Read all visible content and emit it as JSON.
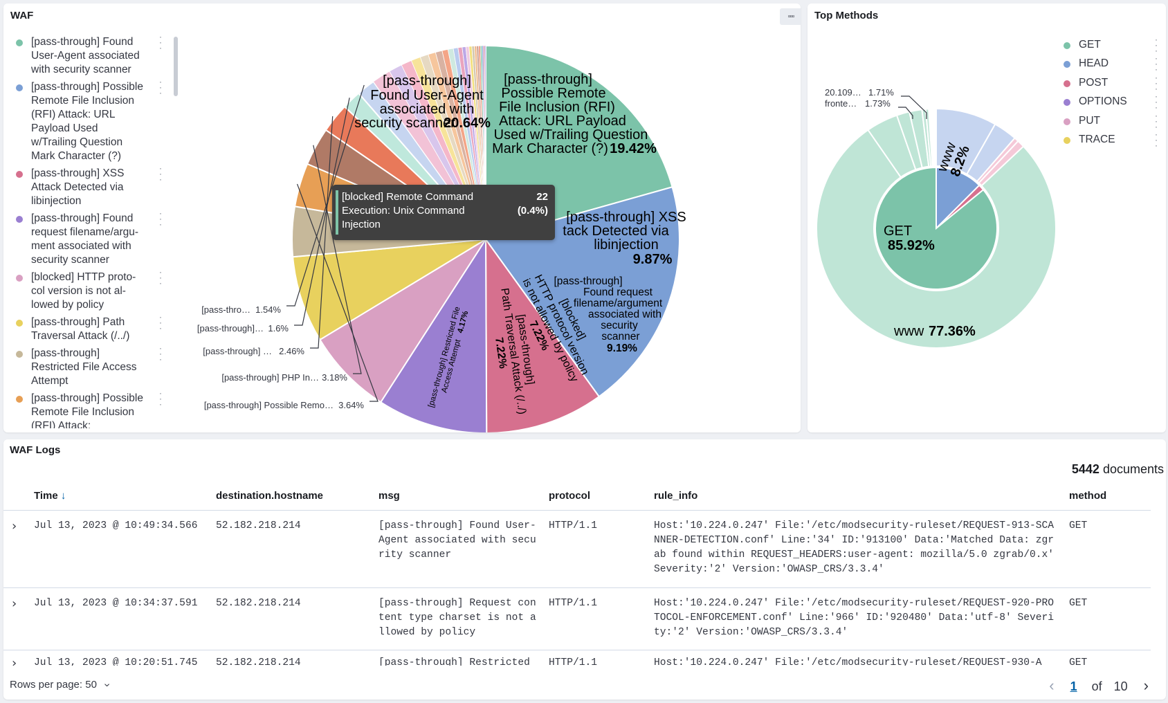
{
  "waf": {
    "title": "WAF",
    "legend": [
      {
        "label": "[pass-through] Found User-Agent associated with security scanner",
        "color": "#7cc3a9"
      },
      {
        "label": "[pass-through] Possible Remote File Inclusion (RFI) Attack: URL Payload Used w/Trailing Question Mark Character (?)",
        "color": "#7b9fd5"
      },
      {
        "label": "[pass-through] XSS Attack Detected via libinjection",
        "color": "#d6708e"
      },
      {
        "label": "[pass-through] Found request filename/argu-ment associated with security scanner",
        "color": "#9a7fd1"
      },
      {
        "label": "[blocked] HTTP proto-col version is not al-lowed by policy",
        "color": "#d9a0c2"
      },
      {
        "label": "[pass-through] Path Traversal Attack (/../)",
        "color": "#e8d15e"
      },
      {
        "label": "[pass-through] Restricted File Access Attempt",
        "color": "#c6b89a"
      },
      {
        "label": "[pass-through] Possible Remote File Inclusion (RFI) Attack:",
        "color": "#e79f55"
      }
    ],
    "slice_labels": {
      "s1_text": "[pass-through] Found User-Agent associated with security scanner",
      "s1_l1": "[pass-through]",
      "s1_l2": "Found User-Agent",
      "s1_l3": "associated with",
      "s1_l4": "security scanner",
      "s1_pct": "20.64%",
      "s2_l1": "[pass-through]",
      "s2_l2": "Possible Remote",
      "s2_l3": "File Inclusion (RFI)",
      "s2_l4": "Attack: URL Payload",
      "s2_l5": "Used w/Trailing Question",
      "s2_l6": "Mark Character (?)",
      "s2_pct": "19.42%",
      "s3_l1": "[pass-through] XSS",
      "s3_l2": "tack Detected via",
      "s3_l3": "libinjection",
      "s3_pct": "9.87%",
      "s4_l1": "[pass-through]",
      "s4_l2": "Found request",
      "s4_l3": "filename/argument",
      "s4_l4": "associated with",
      "s4_l5": "security",
      "s4_l6": "scanner",
      "s4_pct": "9.19%",
      "s5_l1": "[blocked]",
      "s5_l2": "HTTP protocol version",
      "s5_l3": "is not allowed by policy",
      "s5_pct": "7.22%",
      "s6_l1": "[pass-through]",
      "s6_l2": "Path Traversal Attack (/../)",
      "s6_pct": "7.22%",
      "s7_l1": "[pass-through] Restricted File",
      "s7_l2": "Access Attempt",
      "s7_pct": "4.17%"
    },
    "outside_labels": [
      {
        "name": "[pass-through] Possible Remo…",
        "pct": "3.64%"
      },
      {
        "name": "[pass-through] PHP In…",
        "pct": "3.18%"
      },
      {
        "name": "[pass-through] …",
        "pct": "2.46%"
      },
      {
        "name": "[pass-through]…",
        "pct": "1.6%"
      },
      {
        "name": "[pass-thro…",
        "pct": "1.54%"
      }
    ],
    "tooltip": {
      "line1": "[blocked] Remote Command",
      "line2": "Execution: Unix Command",
      "line3": "Injection",
      "count": "22",
      "pct": "(0.4%)"
    }
  },
  "top_methods": {
    "title": "Top Methods",
    "legend": [
      {
        "label": "GET",
        "color": "#7cc3a9"
      },
      {
        "label": "HEAD",
        "color": "#7b9fd5"
      },
      {
        "label": "POST",
        "color": "#d6708e"
      },
      {
        "label": "OPTIONS",
        "color": "#9a7fd1"
      },
      {
        "label": "PUT",
        "color": "#d9a0c2"
      },
      {
        "label": "TRACE",
        "color": "#e8d15e"
      }
    ],
    "inner_label": "GET",
    "inner_pct": "85.92%",
    "outer_label": "www",
    "outer_pct": "77.36%",
    "small_label": "www",
    "small_pct": "8.2%",
    "callout1_name": "20.109…",
    "callout1_pct": "1.71%",
    "callout2_name": "fronte…",
    "callout2_pct": "1.73%"
  },
  "logs": {
    "title": "WAF Logs",
    "doc_count": "5442",
    "doc_label": "documents",
    "sort_arrow": "↓",
    "columns": [
      "Time",
      "destination.hostname",
      "msg",
      "protocol",
      "rule_info",
      "method"
    ],
    "rows": [
      {
        "time": "Jul 13, 2023 @ 10:49:34.566",
        "host": "52.182.218.214",
        "msg": "[pass-through] Found User-Agent associated with security scanner",
        "protocol": "HTTP/1.1",
        "rule": "Host:'10.224.0.247' File:'/etc/modsecurity-ruleset/REQUEST-913-SCANNER-DETECTION.conf' Line:'34' ID:'913100' Data:'Matched Data: zgrab found within REQUEST_HEADERS:user-agent: mozilla/5.0 zgrab/0.x' Severity:'2' Version:'OWASP_CRS/3.3.4'",
        "method": "GET"
      },
      {
        "time": "Jul 13, 2023 @ 10:34:37.591",
        "host": "52.182.218.214",
        "msg": "[pass-through] Request content type charset is not allowed by policy",
        "protocol": "HTTP/1.1",
        "rule": "Host:'10.224.0.247' File:'/etc/modsecurity-ruleset/REQUEST-920-PROTOCOL-ENFORCEMENT.conf' Line:'966' ID:'920480' Data:'utf-8' Severity:'2' Version:'OWASP_CRS/3.3.4'",
        "method": "GET"
      },
      {
        "time": "Jul 13, 2023 @ 10:20:51.745",
        "host": "52.182.218.214",
        "msg": "[pass-through] Restricted",
        "protocol": "HTTP/1.1",
        "rule": "Host:'10.224.0.247' File:'/etc/modsecurity-ruleset/REQUEST-930-A",
        "method": "GET"
      }
    ],
    "rows_per_page_label": "Rows per page: 50",
    "page_current": "1",
    "page_of": "of",
    "page_total": "10"
  }
}
